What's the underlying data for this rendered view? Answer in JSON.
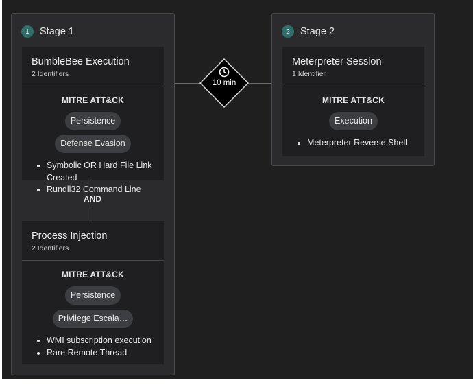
{
  "stages": [
    {
      "number": "1",
      "title": "Stage 1",
      "cards": [
        {
          "title": "BumbleBee Execution",
          "subtitle": "2 Identifiers",
          "mitre_title": "MITRE ATT&CK",
          "tactics": [
            "Persistence",
            "Defense Evasion"
          ],
          "identifiers": [
            "Symbolic OR Hard File Link Created",
            "Rundll32 Command Line"
          ]
        },
        {
          "title": "Process Injection",
          "subtitle": "2 Identifiers",
          "mitre_title": "MITRE ATT&CK",
          "tactics": [
            "Persistence",
            "Privilege Escala…"
          ],
          "identifiers": [
            "WMI subscription execution",
            "Rare Remote Thread"
          ]
        }
      ],
      "operator": "AND"
    },
    {
      "number": "2",
      "title": "Stage 2",
      "cards": [
        {
          "title": "Meterpreter Session",
          "subtitle": "1 Identifier",
          "mitre_title": "MITRE ATT&CK",
          "tactics": [
            "Execution"
          ],
          "identifiers": [
            "Meterpreter Reverse Shell"
          ]
        }
      ]
    }
  ],
  "timer": {
    "label": "10 min",
    "icon": "clock-icon"
  },
  "colors": {
    "canvas": "#1f1f20",
    "stage_bg": "#2b2b2d",
    "card_bg": "#1f1f21",
    "badge": "#2f6f6b",
    "chip": "#3d3e41"
  }
}
